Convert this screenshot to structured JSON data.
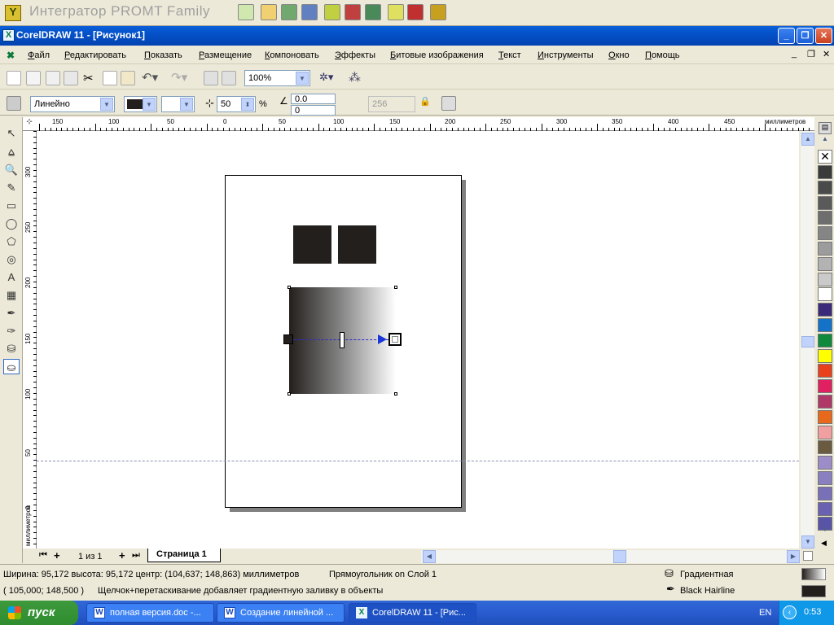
{
  "promt": {
    "title": "Интегратор PROMT Family"
  },
  "window": {
    "title": "CorelDRAW 11 - [Рисунок1]"
  },
  "menu": [
    "Файл",
    "Редактировать",
    "Показать",
    "Размещение",
    "Компоновать",
    "Эффекты",
    "Битовые изображения",
    "Текст",
    "Инструменты",
    "Окно",
    "Помощь"
  ],
  "toolbar": {
    "zoom": "100%"
  },
  "property_bar": {
    "fill_type": "Линейно",
    "midpoint": "50",
    "percent": "%",
    "angle": "0.0",
    "edge_pad": "0",
    "steps": "256"
  },
  "rulers": {
    "h_labels": [
      "150",
      "100",
      "50",
      "0",
      "50",
      "100",
      "150",
      "200",
      "250",
      "300",
      "350",
      "400",
      "450"
    ],
    "unit": "миллиметров",
    "v_labels": [
      "300",
      "250",
      "200",
      "150",
      "100",
      "50",
      "0"
    ],
    "v_unit": "миллиметров"
  },
  "page_nav": {
    "counter": "1 из 1",
    "tab": "Страница 1"
  },
  "status": {
    "dimensions": "Ширина: 95,172  высота: 95,172  центр: (104,637; 148,863)  миллиметров",
    "object": "Прямоугольник on Слой 1",
    "coords": "( 105,000; 148,500 )",
    "hint": "Щелчок+перетаскивание добавляет градиентную заливку в объекты",
    "fill_name": "Градиентная",
    "outline_name": "Black  Hairline"
  },
  "taskbar": {
    "start": "пуск",
    "tasks": [
      "полная версия.doc -...",
      "Создание линейной ...",
      "CorelDRAW 11 - [Рис..."
    ],
    "lang": "EN",
    "time": "0:53"
  },
  "palette": [
    "#3a3a3a",
    "#4a4a4a",
    "#5a5a5a",
    "#6e6e6e",
    "#858585",
    "#9c9c9c",
    "#b3b3b3",
    "#cacaca",
    "#ffffff",
    "#3b2a7a",
    "#1473c9",
    "#0f8a3c",
    "#ffff00",
    "#e8401c",
    "#e02060",
    "#b03868",
    "#e8681c",
    "#f0a0a0",
    "#6a5a40",
    "#9c8cc8",
    "#8a80c0",
    "#7a70b8",
    "#6a62b0",
    "#5a54a8"
  ]
}
